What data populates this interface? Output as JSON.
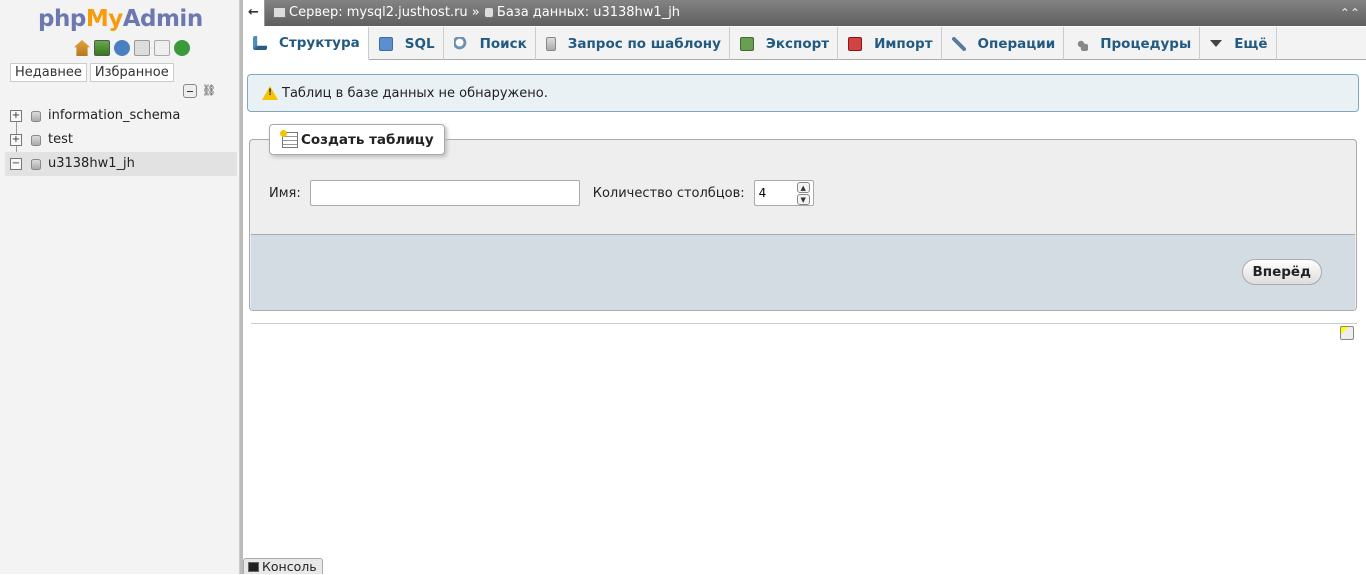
{
  "app": {
    "logo_php": "php",
    "logo_my": "My",
    "logo_admin": "Admin"
  },
  "nav": {
    "icons": [
      "home-icon",
      "exit-icon",
      "help-icon",
      "docs-icon",
      "docs-icon",
      "reload-icon"
    ],
    "tabs": [
      "Недавнее",
      "Избранное"
    ],
    "databases": [
      {
        "name": "information_schema",
        "expander": "+",
        "active": false
      },
      {
        "name": "test",
        "expander": "+",
        "active": false
      },
      {
        "name": "u3138hw1_jh",
        "expander": "−",
        "active": true
      }
    ]
  },
  "breadcrumb": {
    "server": "Сервер: mysql2.justhost.ru",
    "separator": "»",
    "database": "База данных: u3138hw1_jh"
  },
  "tabs": [
    {
      "label": "Структура",
      "icon": "structure-icon",
      "active": true
    },
    {
      "label": "SQL",
      "icon": "sql-icon"
    },
    {
      "label": "Поиск",
      "icon": "search-icon"
    },
    {
      "label": "Запрос по шаблону",
      "icon": "query-icon"
    },
    {
      "label": "Экспорт",
      "icon": "export-icon"
    },
    {
      "label": "Импорт",
      "icon": "import-icon"
    },
    {
      "label": "Операции",
      "icon": "wrench-icon"
    },
    {
      "label": "Процедуры",
      "icon": "procedures-icon"
    },
    {
      "label": "Ещё",
      "icon": "chevron-down-icon"
    }
  ],
  "notice": {
    "text": "Таблиц в базе данных не обнаружено."
  },
  "create_table": {
    "legend": "Создать таблицу",
    "name_label": "Имя:",
    "name_value": "",
    "columns_label": "Количество столбцов:",
    "columns_value": "4",
    "go_label": "Вперёд"
  },
  "console": {
    "label": "Консоль"
  },
  "colors": {
    "tab_text": "#235a81",
    "topbar": "#6f6f6f",
    "notice_bg": "#eaf1f5",
    "footer_bg": "#d3dce3",
    "logo_orange": "#f89c0e",
    "logo_blue": "#6c78af"
  }
}
